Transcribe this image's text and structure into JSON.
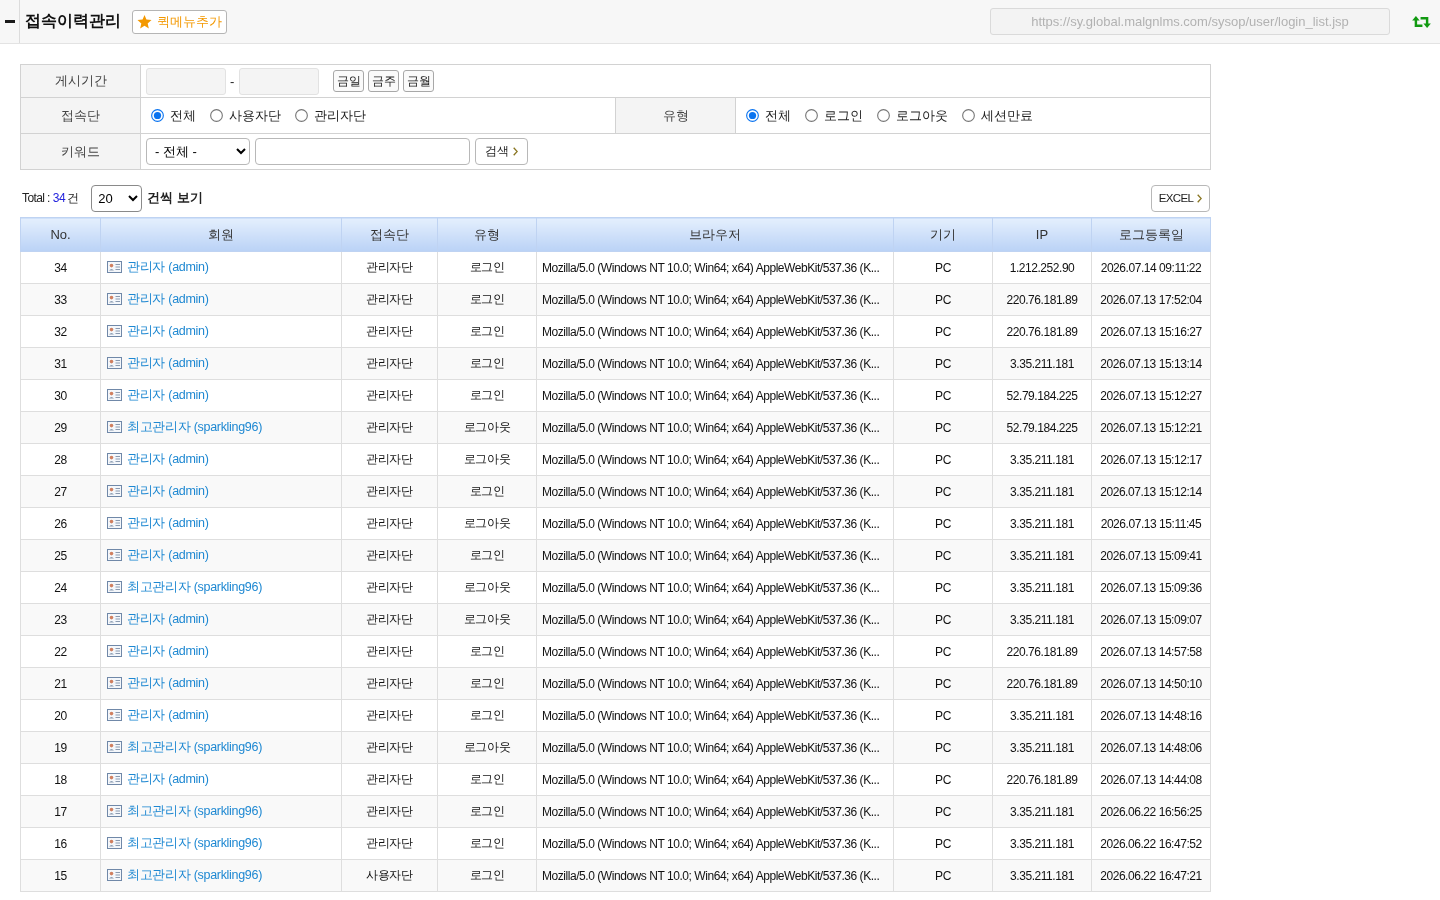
{
  "header": {
    "title": "접속이력관리",
    "quick_menu_button": "퀵메뉴추가",
    "url": "https://sy.global.malgnlms.com/sysop/user/login_list.jsp"
  },
  "filters": {
    "period": {
      "label": "게시기간",
      "separator": "-",
      "buttons": [
        "금일",
        "금주",
        "금월"
      ]
    },
    "site": {
      "label": "접속단",
      "options": [
        {
          "label": "전체",
          "selected": true
        },
        {
          "label": "사용자단",
          "selected": false
        },
        {
          "label": "관리자단",
          "selected": false
        }
      ]
    },
    "type": {
      "label": "유형",
      "options": [
        {
          "label": "전체",
          "selected": true
        },
        {
          "label": "로그인",
          "selected": false
        },
        {
          "label": "로그아웃",
          "selected": false
        },
        {
          "label": "세션만료",
          "selected": false
        }
      ]
    },
    "keyword": {
      "label": "키워드",
      "select": "- 전체 -",
      "search_button": "검색"
    }
  },
  "list_summary": {
    "total_label": "Total :",
    "total_count": "34",
    "total_unit": "건",
    "page_size": "20",
    "page_size_label": "건씩 보기",
    "excel_button": "EXCEL"
  },
  "table": {
    "columns": [
      "No.",
      "회원",
      "접속단",
      "유형",
      "브라우저",
      "기기",
      "IP",
      "로그등록일"
    ],
    "rows": [
      {
        "no": "34",
        "member": "관리자 (admin)",
        "site": "관리자단",
        "type": "로그인",
        "browser": "Mozilla/5.0 (Windows NT 10.0; Win64; x64) AppleWebKit/537.36 (K...",
        "device": "PC",
        "ip": "1.212.252.90",
        "date": "2026.07.14 09:11:22"
      },
      {
        "no": "33",
        "member": "관리자 (admin)",
        "site": "관리자단",
        "type": "로그인",
        "browser": "Mozilla/5.0 (Windows NT 10.0; Win64; x64) AppleWebKit/537.36 (K...",
        "device": "PC",
        "ip": "220.76.181.89",
        "date": "2026.07.13 17:52:04"
      },
      {
        "no": "32",
        "member": "관리자 (admin)",
        "site": "관리자단",
        "type": "로그인",
        "browser": "Mozilla/5.0 (Windows NT 10.0; Win64; x64) AppleWebKit/537.36 (K...",
        "device": "PC",
        "ip": "220.76.181.89",
        "date": "2026.07.13 15:16:27"
      },
      {
        "no": "31",
        "member": "관리자 (admin)",
        "site": "관리자단",
        "type": "로그인",
        "browser": "Mozilla/5.0 (Windows NT 10.0; Win64; x64) AppleWebKit/537.36 (K...",
        "device": "PC",
        "ip": "3.35.211.181",
        "date": "2026.07.13 15:13:14"
      },
      {
        "no": "30",
        "member": "관리자 (admin)",
        "site": "관리자단",
        "type": "로그인",
        "browser": "Mozilla/5.0 (Windows NT 10.0; Win64; x64) AppleWebKit/537.36 (K...",
        "device": "PC",
        "ip": "52.79.184.225",
        "date": "2026.07.13 15:12:27"
      },
      {
        "no": "29",
        "member": "최고관리자 (sparkling96)",
        "site": "관리자단",
        "type": "로그아웃",
        "browser": "Mozilla/5.0 (Windows NT 10.0; Win64; x64) AppleWebKit/537.36 (K...",
        "device": "PC",
        "ip": "52.79.184.225",
        "date": "2026.07.13 15:12:21"
      },
      {
        "no": "28",
        "member": "관리자 (admin)",
        "site": "관리자단",
        "type": "로그아웃",
        "browser": "Mozilla/5.0 (Windows NT 10.0; Win64; x64) AppleWebKit/537.36 (K...",
        "device": "PC",
        "ip": "3.35.211.181",
        "date": "2026.07.13 15:12:17"
      },
      {
        "no": "27",
        "member": "관리자 (admin)",
        "site": "관리자단",
        "type": "로그인",
        "browser": "Mozilla/5.0 (Windows NT 10.0; Win64; x64) AppleWebKit/537.36 (K...",
        "device": "PC",
        "ip": "3.35.211.181",
        "date": "2026.07.13 15:12:14"
      },
      {
        "no": "26",
        "member": "관리자 (admin)",
        "site": "관리자단",
        "type": "로그아웃",
        "browser": "Mozilla/5.0 (Windows NT 10.0; Win64; x64) AppleWebKit/537.36 (K...",
        "device": "PC",
        "ip": "3.35.211.181",
        "date": "2026.07.13 15:11:45"
      },
      {
        "no": "25",
        "member": "관리자 (admin)",
        "site": "관리자단",
        "type": "로그인",
        "browser": "Mozilla/5.0 (Windows NT 10.0; Win64; x64) AppleWebKit/537.36 (K...",
        "device": "PC",
        "ip": "3.35.211.181",
        "date": "2026.07.13 15:09:41"
      },
      {
        "no": "24",
        "member": "최고관리자 (sparkling96)",
        "site": "관리자단",
        "type": "로그아웃",
        "browser": "Mozilla/5.0 (Windows NT 10.0; Win64; x64) AppleWebKit/537.36 (K...",
        "device": "PC",
        "ip": "3.35.211.181",
        "date": "2026.07.13 15:09:36"
      },
      {
        "no": "23",
        "member": "관리자 (admin)",
        "site": "관리자단",
        "type": "로그아웃",
        "browser": "Mozilla/5.0 (Windows NT 10.0; Win64; x64) AppleWebKit/537.36 (K...",
        "device": "PC",
        "ip": "3.35.211.181",
        "date": "2026.07.13 15:09:07"
      },
      {
        "no": "22",
        "member": "관리자 (admin)",
        "site": "관리자단",
        "type": "로그인",
        "browser": "Mozilla/5.0 (Windows NT 10.0; Win64; x64) AppleWebKit/537.36 (K...",
        "device": "PC",
        "ip": "220.76.181.89",
        "date": "2026.07.13 14:57:58"
      },
      {
        "no": "21",
        "member": "관리자 (admin)",
        "site": "관리자단",
        "type": "로그인",
        "browser": "Mozilla/5.0 (Windows NT 10.0; Win64; x64) AppleWebKit/537.36 (K...",
        "device": "PC",
        "ip": "220.76.181.89",
        "date": "2026.07.13 14:50:10"
      },
      {
        "no": "20",
        "member": "관리자 (admin)",
        "site": "관리자단",
        "type": "로그인",
        "browser": "Mozilla/5.0 (Windows NT 10.0; Win64; x64) AppleWebKit/537.36 (K...",
        "device": "PC",
        "ip": "3.35.211.181",
        "date": "2026.07.13 14:48:16"
      },
      {
        "no": "19",
        "member": "최고관리자 (sparkling96)",
        "site": "관리자단",
        "type": "로그아웃",
        "browser": "Mozilla/5.0 (Windows NT 10.0; Win64; x64) AppleWebKit/537.36 (K...",
        "device": "PC",
        "ip": "3.35.211.181",
        "date": "2026.07.13 14:48:06"
      },
      {
        "no": "18",
        "member": "관리자 (admin)",
        "site": "관리자단",
        "type": "로그인",
        "browser": "Mozilla/5.0 (Windows NT 10.0; Win64; x64) AppleWebKit/537.36 (K...",
        "device": "PC",
        "ip": "220.76.181.89",
        "date": "2026.07.13 14:44:08"
      },
      {
        "no": "17",
        "member": "최고관리자 (sparkling96)",
        "site": "관리자단",
        "type": "로그인",
        "browser": "Mozilla/5.0 (Windows NT 10.0; Win64; x64) AppleWebKit/537.36 (K...",
        "device": "PC",
        "ip": "3.35.211.181",
        "date": "2026.06.22 16:56:25"
      },
      {
        "no": "16",
        "member": "최고관리자 (sparkling96)",
        "site": "관리자단",
        "type": "로그인",
        "browser": "Mozilla/5.0 (Windows NT 10.0; Win64; x64) AppleWebKit/537.36 (K...",
        "device": "PC",
        "ip": "3.35.211.181",
        "date": "2026.06.22 16:47:52"
      },
      {
        "no": "15",
        "member": "최고관리자 (sparkling96)",
        "site": "사용자단",
        "type": "로그인",
        "browser": "Mozilla/5.0 (Windows NT 10.0; Win64; x64) AppleWebKit/537.36 (K...",
        "device": "PC",
        "ip": "3.35.211.181",
        "date": "2026.06.22 16:47:21"
      }
    ]
  }
}
